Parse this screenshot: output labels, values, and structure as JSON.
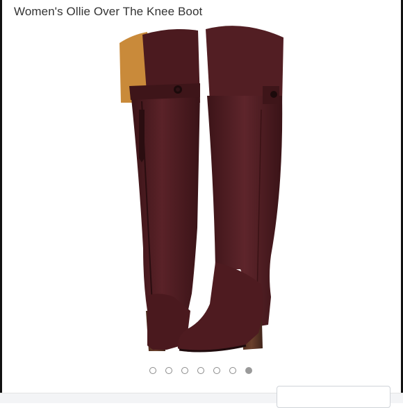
{
  "product": {
    "title": "Women's Ollie Over The Knee Boot"
  },
  "colors": {
    "boot_leather": "#4a1b1f",
    "boot_lining": "#c98a3a",
    "heel": "#5a3424",
    "dot_active": "#9a9a9a",
    "dot_inactive_border": "#8a8a8a"
  },
  "carousel": {
    "total": 7,
    "active_index": 6
  }
}
